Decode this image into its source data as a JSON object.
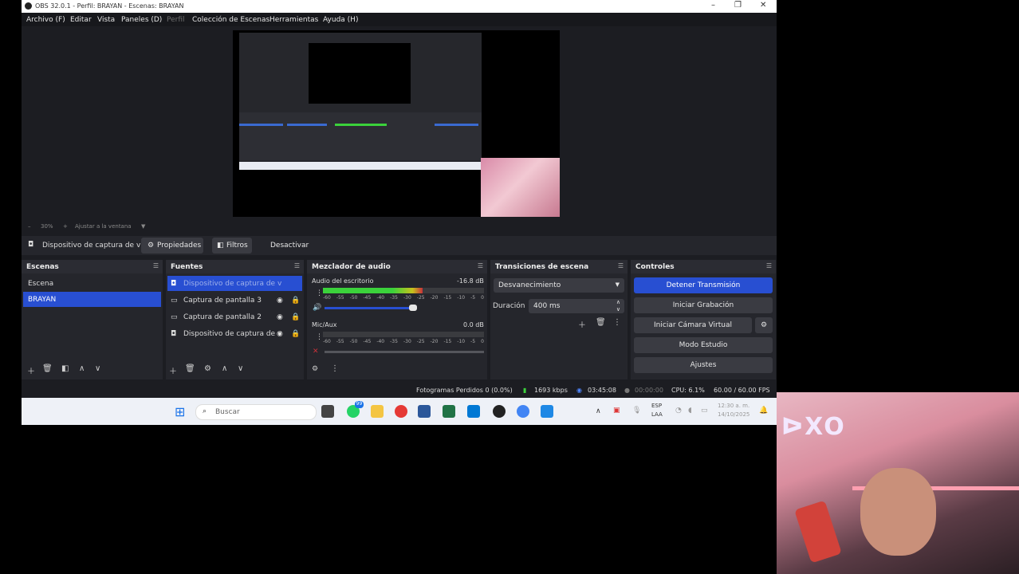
{
  "window": {
    "title": "OBS 32.0.1 - Perfil: BRAYAN - Escenas: BRAYAN",
    "controls": [
      "–",
      "❐",
      "✕"
    ]
  },
  "menu": [
    "Archivo (F)",
    "Editar",
    "Vista",
    "Paneles (D)",
    "Perfil",
    "Colección de Escenas",
    "Herramientas",
    "Ayuda (H)"
  ],
  "zoom": {
    "minus": "–",
    "value": "30%",
    "plus": "+",
    "fit": "Ajustar a la ventana"
  },
  "source_bar": {
    "selected_source": "Dispositivo de captura de v",
    "properties": "Propiedades",
    "filters": "Filtros",
    "deactivate": "Desactivar"
  },
  "scenes": {
    "title": "Escenas",
    "items": [
      "Escena",
      "BRAYAN"
    ],
    "selected_index": 1
  },
  "sources": {
    "title": "Fuentes",
    "items": [
      {
        "label": "Dispositivo de captura de v",
        "icon": "camera-icon",
        "selected": true
      },
      {
        "label": "Captura de pantalla 3",
        "icon": "monitor-icon",
        "selected": false
      },
      {
        "label": "Captura de pantalla 2",
        "icon": "monitor-icon",
        "selected": false
      },
      {
        "label": "Dispositivo de captura de v",
        "icon": "camera-icon",
        "selected": false
      }
    ]
  },
  "mixer": {
    "title": "Mezclador de audio",
    "channels": [
      {
        "name": "Audio del escritorio",
        "db": "-16.8 dB",
        "level": 0.62,
        "volume": 0.72
      },
      {
        "name": "Mic/Aux",
        "db": "0.0 dB",
        "level": 0.0,
        "volume": 1.0
      }
    ],
    "scale": [
      "-60",
      "-55",
      "-50",
      "-45",
      "-40",
      "-35",
      "-30",
      "-25",
      "-20",
      "-15",
      "-10",
      "-5",
      "0"
    ]
  },
  "transitions": {
    "title": "Transiciones de escena",
    "selected": "Desvanecimiento",
    "duration_label": "Duración",
    "duration_value": "400 ms"
  },
  "controls": {
    "title": "Controles",
    "stop_stream": "Detener Transmisión",
    "start_recording": "Iniciar Grabación",
    "start_virtual_cam": "Iniciar Cámara Virtual",
    "studio_mode": "Modo Estudio",
    "settings": "Ajustes"
  },
  "status": {
    "dropped_frames": "Fotogramas Perdidos 0 (0.0%)",
    "bitrate": "1693 kbps",
    "stream_time": "03:45:08",
    "record_time": "00:00:00",
    "cpu": "CPU: 6.1%",
    "fps": "60.00 / 60.00 FPS"
  },
  "taskbar": {
    "search_placeholder": "Buscar",
    "lang": "ESP",
    "region": "LAA",
    "time": "12:30 a. m.",
    "date": "14/10/2025",
    "badge": "99"
  },
  "webcam": {
    "sign_text": "ᐅXO"
  },
  "colors": {
    "accent": "#284fd2",
    "panel": "#25262c",
    "bg": "#1c1d22",
    "meter_green": "#3bd23b",
    "meter_yellow": "#c7c21d",
    "meter_red": "#c8313a"
  }
}
